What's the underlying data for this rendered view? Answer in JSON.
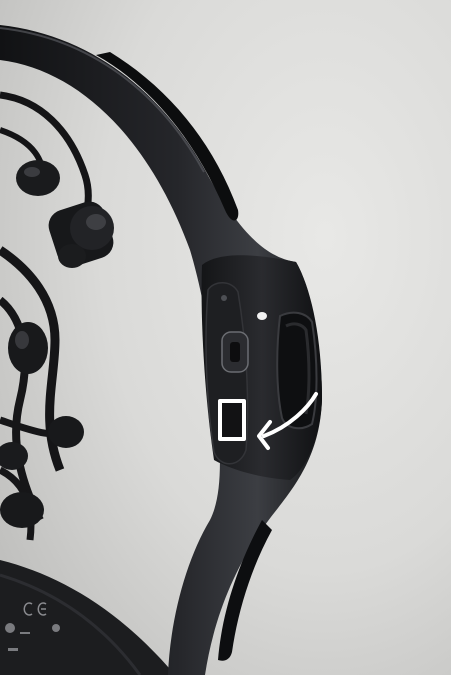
{
  "photo": {
    "subject": "eeg-headset-side-view",
    "colors": {
      "background": "#dcdcda",
      "device_body": "#1b1c1e",
      "device_highlight": "#4a4c50",
      "annotation": "#ffffff"
    }
  },
  "annotation": {
    "shape": "square-with-arrow",
    "color": "#ffffff"
  }
}
